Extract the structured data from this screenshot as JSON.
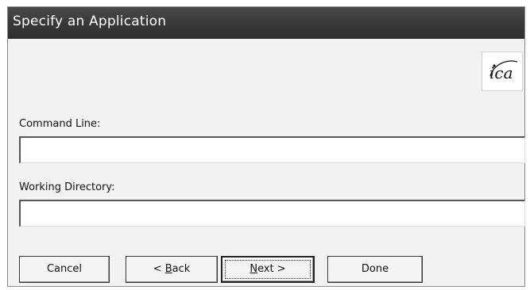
{
  "window": {
    "title": "Specify an Application"
  },
  "logo": {
    "icon": "ica-logo-icon",
    "text": "ica"
  },
  "fields": {
    "command_line": {
      "label": "Command Line:",
      "value": ""
    },
    "working_directory": {
      "label": "Working Directory:",
      "value": ""
    }
  },
  "buttons": {
    "cancel": {
      "label": "Cancel"
    },
    "back": {
      "prefix": "< ",
      "mnemonic": "B",
      "rest": "ack"
    },
    "next": {
      "mnemonic": "N",
      "rest": "ext >"
    },
    "done": {
      "label": "Done"
    }
  }
}
